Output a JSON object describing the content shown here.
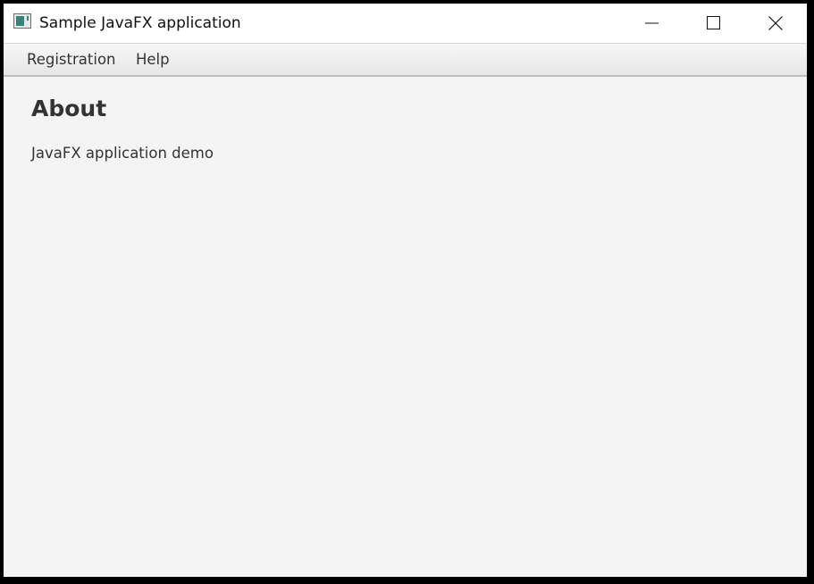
{
  "window": {
    "title": "Sample JavaFX application",
    "icon": "java-app-icon",
    "controls": {
      "minimize_icon": "minimize-icon",
      "maximize_icon": "maximize-icon",
      "close_icon": "close-icon"
    }
  },
  "menubar": {
    "items": [
      {
        "label": "Registration"
      },
      {
        "label": "Help"
      }
    ]
  },
  "content": {
    "title": "About",
    "text": "JavaFX application demo"
  },
  "colors": {
    "window_background": "#f4f4f4",
    "titlebar_background": "#ffffff",
    "text": "#333333",
    "frame": "#000000"
  }
}
